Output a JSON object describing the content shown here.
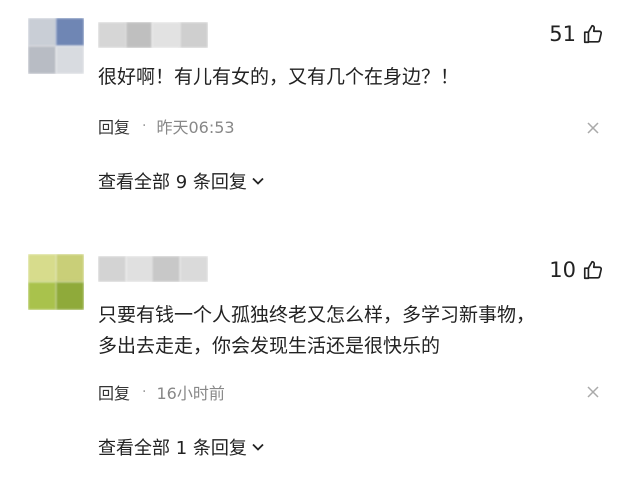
{
  "comments": [
    {
      "likes": "51",
      "text_lines": [
        "很好啊！有儿有女的，又有几个在身边？！"
      ],
      "reply_label": "回复",
      "separator": "·",
      "time": "昨天06:53",
      "view_replies": "查看全部 9 条回复"
    },
    {
      "likes": "10",
      "text_lines": [
        "只要有钱一个人孤独终老又怎么样，多学习新事物，",
        "多出去走走，你会发现生活还是很快乐的"
      ],
      "reply_label": "回复",
      "separator": "·",
      "time": "16小时前",
      "view_replies": "查看全部 1 条回复"
    }
  ],
  "colors": {
    "text": "#222222",
    "meta": "#888888",
    "background": "#ffffff"
  },
  "icons": [
    "thumbs-up-icon",
    "close-icon",
    "chevron-down-icon"
  ]
}
